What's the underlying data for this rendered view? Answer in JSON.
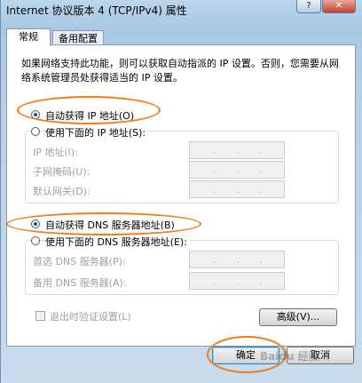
{
  "window": {
    "title": "Internet 协议版本 4 (TCP/IPv4) 属性",
    "help_label": "?",
    "close_label": "✕"
  },
  "tabs": [
    {
      "label": "常规",
      "active": true
    },
    {
      "label": "备用配置",
      "active": false
    }
  ],
  "description": "如果网络支持此功能，则可以获取自动指派的 IP 设置。否则，您需要从网络系统管理员处获得适当的 IP 设置。",
  "ip_section": {
    "auto_option": {
      "label": "自动获得 IP 地址(O)",
      "checked": true
    },
    "manual_option": {
      "label": "使用下面的 IP 地址(S):",
      "checked": false
    },
    "fields": [
      {
        "label": "IP 地址(I):",
        "value": ""
      },
      {
        "label": "子网掩码(U):",
        "value": ""
      },
      {
        "label": "默认网关(D):",
        "value": ""
      }
    ]
  },
  "dns_section": {
    "auto_option": {
      "label": "自动获得 DNS 服务器地址(B)",
      "checked": true
    },
    "manual_option": {
      "label": "使用下面的 DNS 服务器地址(E):",
      "checked": false
    },
    "fields": [
      {
        "label": "首选 DNS 服务器(P):",
        "value": ""
      },
      {
        "label": "备用 DNS 服务器(A):",
        "value": ""
      }
    ]
  },
  "validate_checkbox": {
    "label": "退出时验证设置(L)",
    "checked": false
  },
  "advanced_button": "高级(V)...",
  "ok_button": "确定",
  "cancel_button": "取消",
  "ip_separator": ".",
  "watermark_text": "Baidu 经验",
  "colors": {
    "annotation": "#f07d1a",
    "accent": "#1f4e8c"
  }
}
